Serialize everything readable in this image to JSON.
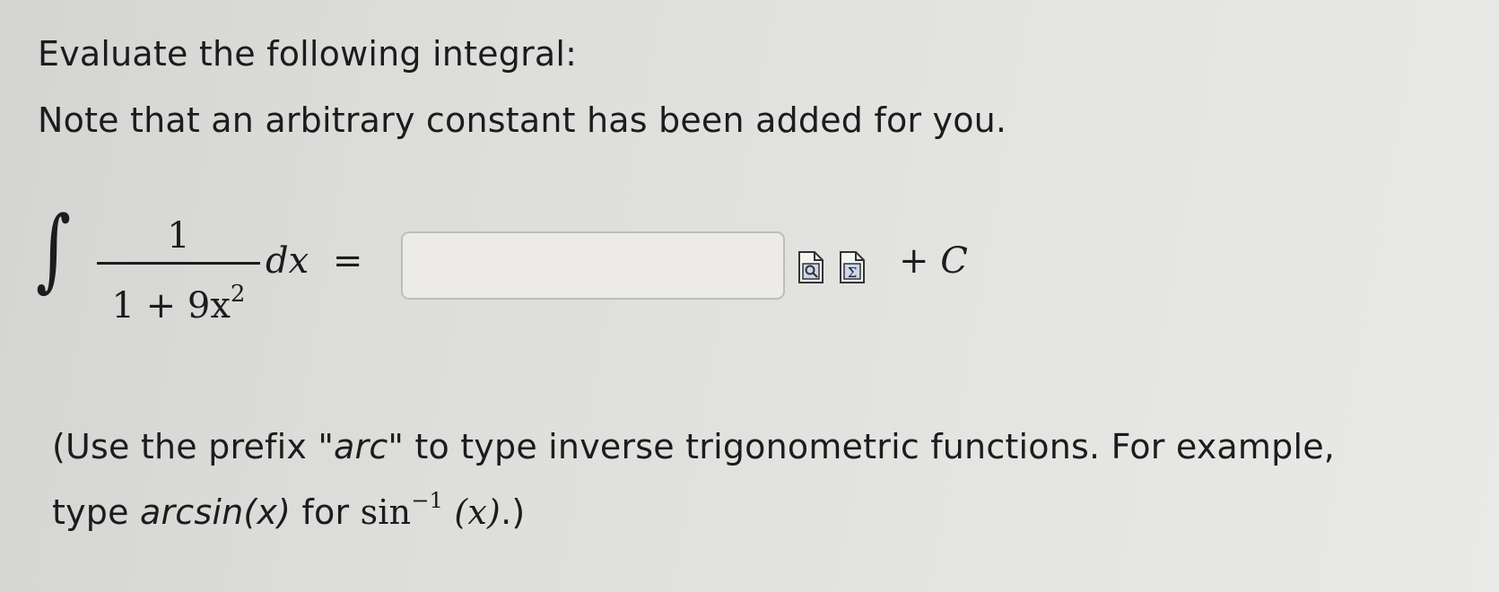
{
  "question": {
    "heading": "Evaluate the following integral:",
    "note": "Note that an arbitrary constant has been added for you."
  },
  "integral": {
    "symbol": "∫",
    "numerator": "1",
    "denominator_base": "1 + 9x",
    "denominator_exponent": "2",
    "differential": "dx",
    "equals": "=",
    "constant": "+ C"
  },
  "answer": {
    "value": "",
    "placeholder": ""
  },
  "tools": {
    "preview_icon": "preview-answer-icon",
    "equation_icon": "equation-editor-icon",
    "equation_glyph": "Σ"
  },
  "hint": {
    "line1_start": "(Use the prefix \"",
    "prefix_word": "arc",
    "line1_end": "\" to type inverse trigonometric functions. For example,",
    "line2_start": "type ",
    "example_typed": "arcsin(x)",
    "line2_mid": " for ",
    "sin_text": "sin",
    "sin_exponent": "−1",
    "sin_arg": "(x)",
    "line2_end": ".)"
  }
}
